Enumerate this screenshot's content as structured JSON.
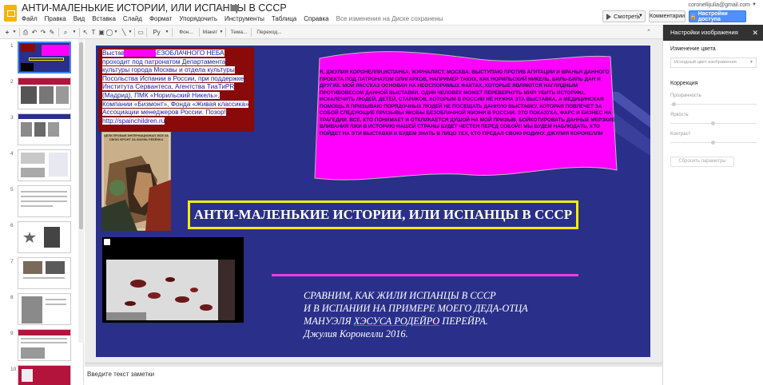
{
  "header": {
    "title": "АНТИ-МАЛЕНЬКИЕ ИСТОРИИ, ИЛИ ИСПАНЦЫ В СССР",
    "menus": [
      "Файл",
      "Правка",
      "Вид",
      "Вставка",
      "Слайд",
      "Формат",
      "Упорядочить",
      "Инструменты",
      "Таблица",
      "Справка"
    ],
    "save_status": "Все изменения на Диске сохранены",
    "user_email": "coronellijulia@gmail.com",
    "present_label": "Смотреть",
    "comments_label": "Комментарии",
    "share_label": "Настройки доступа",
    "share_icon": "lock-icon"
  },
  "toolbar": {
    "zoom_label": "Ру",
    "font_label": "Фон...",
    "layout_label": "Макет",
    "theme_label": "Тема...",
    "transition_label": "Переход..."
  },
  "filmstrip": {
    "slides": [
      {
        "num": "1",
        "selected": true
      },
      {
        "num": "2"
      },
      {
        "num": "3"
      },
      {
        "num": "4"
      },
      {
        "num": "5"
      },
      {
        "num": "6"
      },
      {
        "num": "7"
      },
      {
        "num": "8"
      },
      {
        "num": "9"
      },
      {
        "num": "10"
      }
    ]
  },
  "slide": {
    "intro_text": "Выставка ДЕТИ БЕЗОБЛАЧНОГО НЕБА проходит под патронатом Департамента культуры города Москвы и отдела культуры Посольства Испании в России, при поддержке Института Сервантеса, Агентства ТиаТиРR (Мадрид), ПМК «Норильский Никель», Компании «Бизмонт», Фонда «Живая классика» Ассоциации менеджеров России. Позор! http://spainchildren.ru",
    "poster_caption": "ЦЕЛИ ПРОБЫЕ ИНТЕРНАЦИОНАЛ. ВСЕ ЗА СВОЮ ФРОНТ ЗА ЖИЗНЬ РЕБЁНКА",
    "flag_text": "Я, ДЖУЛИЯ КОРОНЕЛЛИ,ИСПАНКА, ЖУРНАЛИСТ, МОСКВА. ВЫСТУПАЮ ПРОТИВ АГИТАЦИИ И ВРАНЬЯ ДАННОГО ПРОЕКТА ПОД ПАТРОНАТОМ ОЛИГАРХОВ, НАПРИМЕР ТАКИХ, КАК НОРИЛЬСКИЙ НИКЕЛЬ, БИЛЬ-БИЛЬ ДАН И ДРУГИХ. МОЙ РАССКАЗ ОСНОВАН НА НЕОСПОРИМЫХ ФАКТАХ, КОТОРЫЕ ЯВЛЯЮТСЯ НАГЛЯДНЫМ ПРОТИВОВЕСОМ ДАННОЙ ВЫСТАВКИ. ОДИН ЧЕЛОВЕК МОЖЕТ ПЕРЕВЕРНУТЬ МИР! УБИТЬ ИСТОРИЮ, ИСКАЛЕЧИТЬ ЛЮДЕЙ, ДЕТЕЙ, СТАРИКОВ, КОТОРЫМ В РОССИИ НЕ НУЖНА ЭТА ВЫСТАВКА, А МЕДИЦИНСКАЯ ПОМОЩЬ.Я ПРИЗЫВАЮ ПОРЯДОЧНЫХ ЛЮДЕЙ НЕ ПОСЕЩАТЬ ДАННУЮ ВЫСТАВКУ, КОТОРАЯ ПОВЛЕЧЕТ ЗА СОБОЙ СЛЕДУЮЩИЕ ПРИЗЫВЫ ЯКОБЫ БЕЗОБЛАЧНОЙ ЖИЗНИ В РОССИИ. ЭТО ПОКАЗУХА, ФАРС И БИЗНЕС НА ТРАГЕДИИ. ВСЕ, КТО ПОНИМАЕТ И ОТКЛИКАЕТСЯ ДУШОЙ НА МОЙ ПРИЗЫВ, БОЙКОТИРОВАТЬ ДАННЫЕ МЕРЗКИЕ ВЛИВАНИЯ ЛЖИ В ИСТОРИЮ НАШЕЙ СТРАНЫ БУДЕТ ЧЕСТЕН ПЕРЕД СОБОЙ!! МЫ БУДЕМ НАБЛЮДАТЬ, КТО ПОЙДЕТ НА ЭТИ ВЫСТАВКИ И БУДЕМ ЗНАТЬ В ЛИЦО ТЕХ, КТО ПРЕДАЛ СВОЮ РОДИНУ. ДЖУЛИЯ КОРОНЕЛЛИ",
    "title": "АНТИ-МАЛЕНЬКИЕ ИСТОРИИ, ИЛИ ИСПАНЦЫ В СССР",
    "italic_line1": "СРАВНИМ, КАК ЖИЛИ ИСПАНЦЫ В СССР",
    "italic_line2": "И В ИСПАНИИ НА ПРИМЕРЕ МОЕГО ДЕДА-ОТЦА",
    "italic_line3_a": "МАНУЭЛЯ ",
    "italic_line3_b": "ХЭСУСА РОДЕЙРО",
    "italic_line3_c": " ПЕРЕЙРА.",
    "italic_line4": "Джулия Коронелли 2016."
  },
  "notes": {
    "placeholder": "Введите текст заметки"
  },
  "panel": {
    "title": "Настройки изображения",
    "recolor_label": "Изменение цвета",
    "recolor_value": "Исходный цвет изображения",
    "adjust_label": "Коррекция",
    "transparency_label": "Прозрачность",
    "brightness_label": "Яркость",
    "contrast_label": "Контраст",
    "reset_label": "Сбросить параметры"
  },
  "colors": {
    "slide_bg": "#2a2f8a",
    "title_border": "#f5ee00",
    "magenta": "#ff00ff",
    "share_blue": "#4d90fe"
  }
}
